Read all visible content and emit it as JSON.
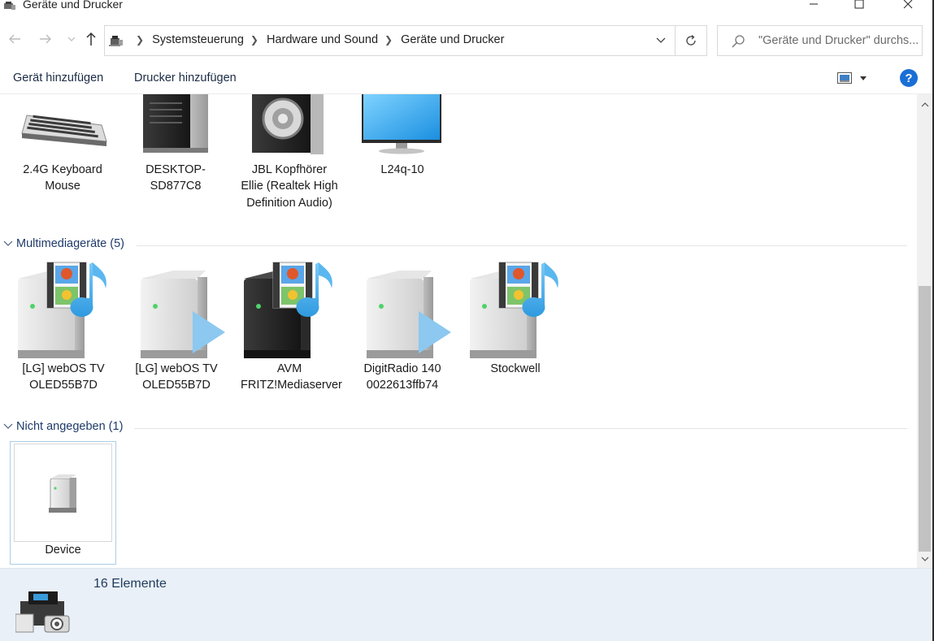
{
  "window": {
    "title": "Geräte und Drucker"
  },
  "navigation": {
    "breadcrumbs": [
      "Systemsteuerung",
      "Hardware und Sound",
      "Geräte und Drucker"
    ],
    "search_placeholder": "\"Geräte und Drucker\" durchs..."
  },
  "toolbar": {
    "add_device": "Gerät hinzufügen",
    "add_printer": "Drucker hinzufügen",
    "help": "?"
  },
  "groups": {
    "devices": {
      "items": [
        {
          "label": "2.4G Keyboard Mouse",
          "icon": "keyboard-icon"
        },
        {
          "label": "DESKTOP-SD877C8",
          "icon": "computer-tower-icon"
        },
        {
          "label": "JBL Kopfhörer Ellie (Realtek High Definition Audio)",
          "icon": "speaker-icon"
        },
        {
          "label": "L24q-10",
          "icon": "monitor-icon"
        }
      ]
    },
    "multimedia": {
      "title": "Multimediageräte (5)",
      "items": [
        {
          "label": "[LG] webOS TV OLED55B7D",
          "icon": "media-server-icon"
        },
        {
          "label": "[LG] webOS TV OLED55B7D",
          "icon": "media-renderer-icon"
        },
        {
          "label": "AVM FRITZ!Mediaserver",
          "icon": "media-server-dark-icon"
        },
        {
          "label": "DigitRadio 140 0022613ffb74",
          "icon": "media-renderer-icon"
        },
        {
          "label": "Stockwell",
          "icon": "media-server-icon"
        }
      ]
    },
    "unspecified": {
      "title": "Nicht angegeben (1)",
      "items": [
        {
          "label": "Device",
          "icon": "generic-device-icon",
          "selected": true
        }
      ]
    }
  },
  "details": {
    "count": "16 Elemente"
  },
  "colors": {
    "accent": "#1a6fd6",
    "group_header": "#1e3a6a",
    "details_bg": "#eaf0f8",
    "selection_border": "#a9cde6"
  }
}
